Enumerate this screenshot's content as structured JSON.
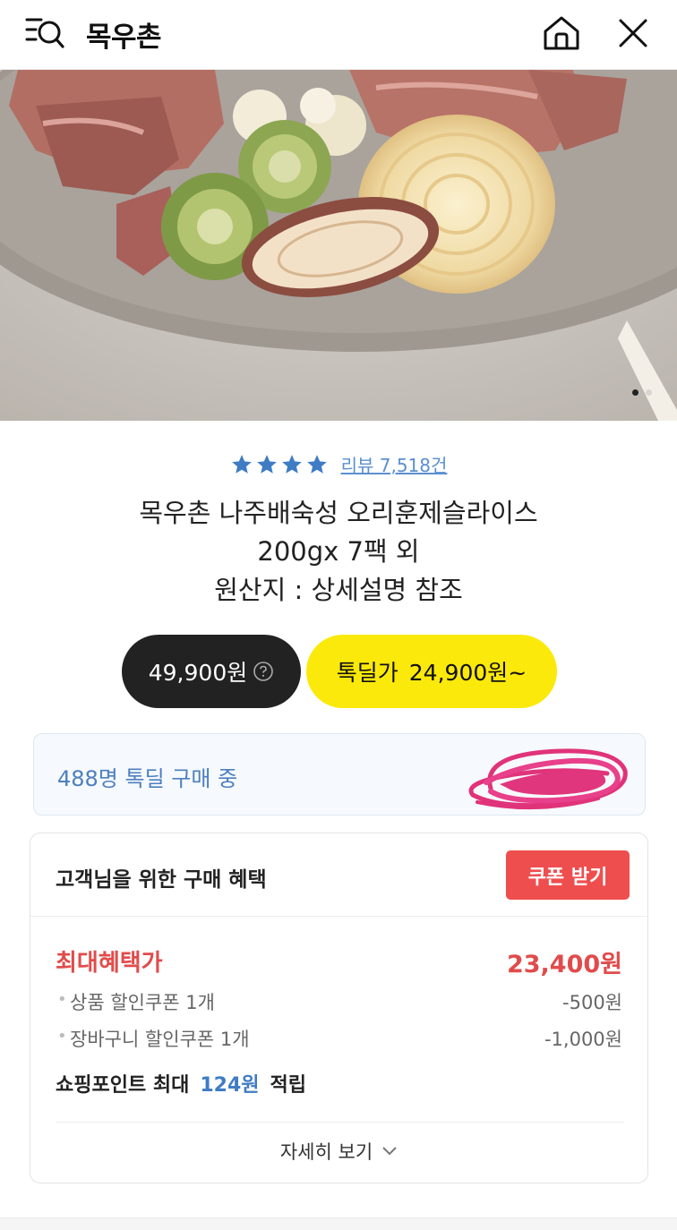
{
  "header": {
    "title": "목우촌",
    "icons": {
      "menu": "menu-search-icon",
      "home": "home-icon",
      "close": "close-icon"
    }
  },
  "hero": {
    "image": "smoked duck slices with roasted vegetables",
    "slide_index": 1,
    "slide_count": 2
  },
  "product": {
    "rating_stars": 4,
    "review_link": "리뷰 7,518건",
    "title_lines": [
      "목우촌 나주배숙성 오리훈제슬라이스",
      "200gx 7팩 외",
      "원산지 : 상세설명 참조"
    ]
  },
  "pricing": {
    "regular_price": "49,900원",
    "deal_label": "톡딜가",
    "deal_price": "24,900원~"
  },
  "buyers": {
    "text": "488명 톡딜 구매 중"
  },
  "benefits": {
    "title": "고객님을 위한 구매 혜택",
    "coupon_button": "쿠폰 받기",
    "max_label": "최대혜택가",
    "max_price": "23,400원",
    "discounts": [
      {
        "label": "상품 할인쿠폰 1개",
        "amount": "-500원"
      },
      {
        "label": "장바구니 할인쿠폰 1개",
        "amount": "-1,000원"
      }
    ],
    "points_prefix": "쇼핑포인트 최대",
    "points_value": "124원",
    "points_suffix": "적립",
    "detail_link": "자세히 보기"
  },
  "colors": {
    "accent_yellow": "#fbe90b",
    "price_black": "#222222",
    "coupon_red": "#ef4e4e",
    "link_blue": "#5b8fd0",
    "star_blue": "#3f7cc4"
  }
}
